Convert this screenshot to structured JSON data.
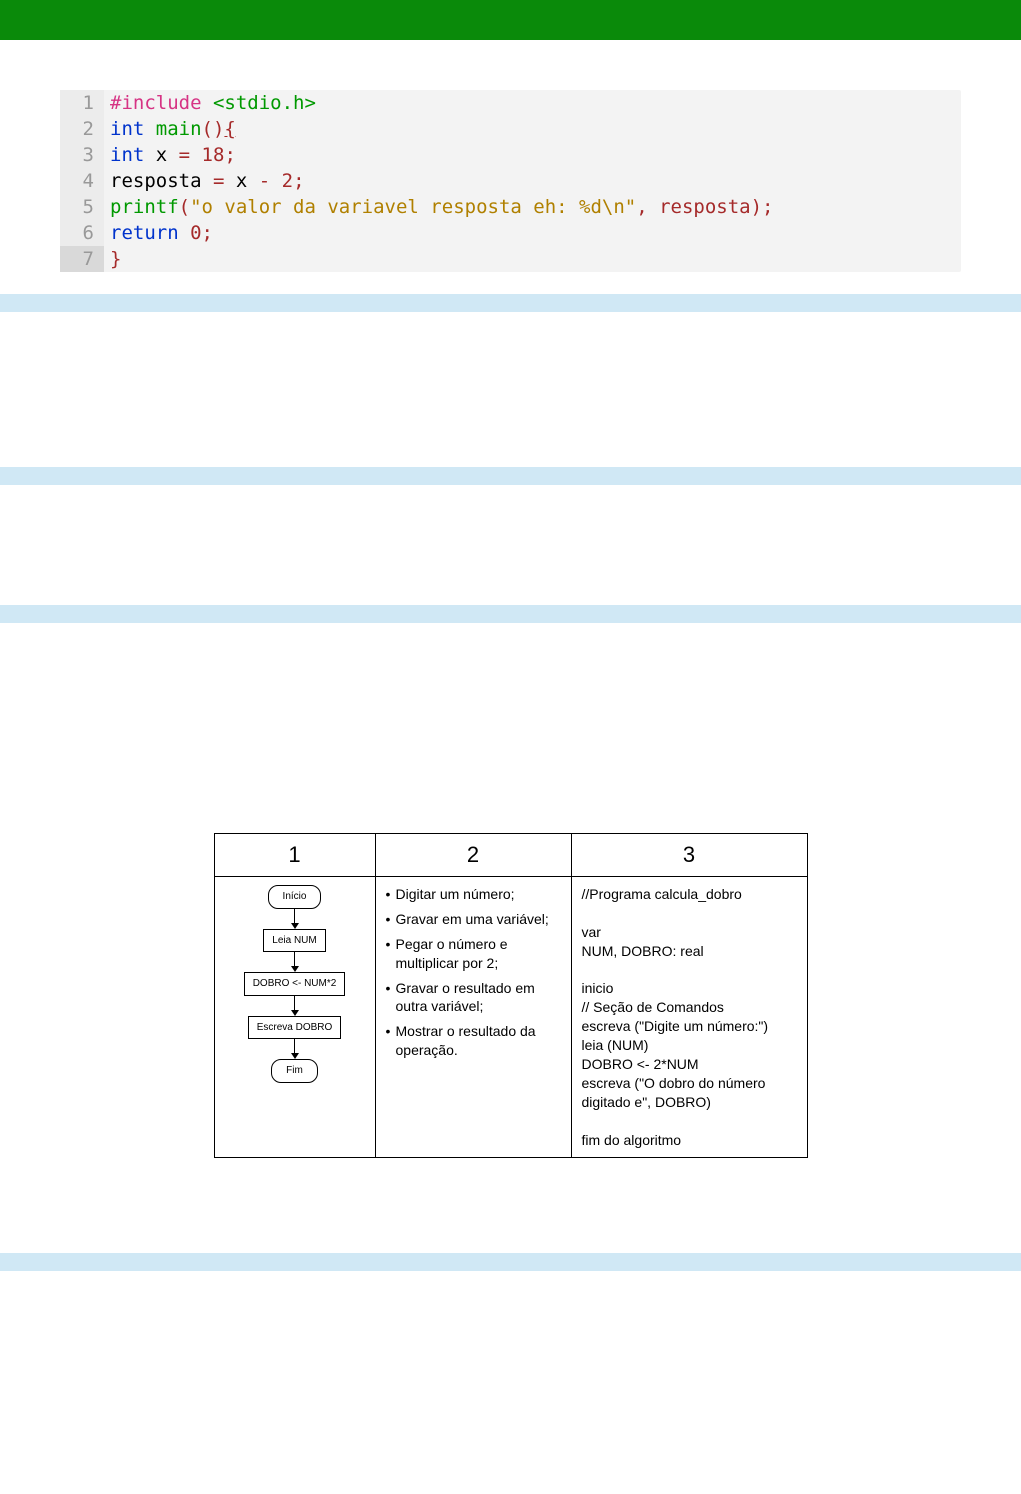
{
  "code": {
    "lines": [
      {
        "n": "1",
        "tokens": [
          {
            "t": "#include ",
            "c": "pre"
          },
          {
            "t": "<stdio.h>",
            "c": "type"
          }
        ]
      },
      {
        "n": "2",
        "tokens": [
          {
            "t": "int ",
            "c": "kw"
          },
          {
            "t": "main",
            "c": "func"
          },
          {
            "t": "()",
            "c": "punct"
          },
          {
            "t": "{",
            "c": "punct",
            "u": true
          }
        ]
      },
      {
        "n": "3",
        "tokens": [
          {
            "t": "    ",
            "c": "ident"
          },
          {
            "t": "int ",
            "c": "kw"
          },
          {
            "t": "x ",
            "c": "ident"
          },
          {
            "t": "= ",
            "c": "punct"
          },
          {
            "t": "18",
            "c": "num"
          },
          {
            "t": ";",
            "c": "punct"
          }
        ]
      },
      {
        "n": "4",
        "tokens": [
          {
            "t": "    resposta ",
            "c": "ident"
          },
          {
            "t": "= ",
            "c": "punct"
          },
          {
            "t": "x ",
            "c": "ident"
          },
          {
            "t": "- ",
            "c": "punct"
          },
          {
            "t": "2",
            "c": "num"
          },
          {
            "t": ";",
            "c": "punct"
          }
        ]
      },
      {
        "n": "5",
        "tokens": [
          {
            "t": "    ",
            "c": "ident"
          },
          {
            "t": "printf",
            "c": "func"
          },
          {
            "t": "(",
            "c": "punct"
          },
          {
            "t": "\"o valor da variavel resposta eh: %d\\n\"",
            "c": "str"
          },
          {
            "t": ", resposta);",
            "c": "punct"
          }
        ]
      },
      {
        "n": "6",
        "tokens": [
          {
            "t": "    ",
            "c": "ident"
          },
          {
            "t": "return ",
            "c": "kw"
          },
          {
            "t": "0",
            "c": "num"
          },
          {
            "t": ";",
            "c": "punct"
          }
        ]
      },
      {
        "n": "7",
        "tokens": [
          {
            "t": "}",
            "c": "punct"
          }
        ]
      }
    ]
  },
  "table": {
    "headers": [
      "1",
      "2",
      "3"
    ],
    "flow": {
      "start": "Início",
      "read": "Leia NUM",
      "calc": "DOBRO <- NUM*2",
      "write": "Escreva DOBRO",
      "end": "Fim"
    },
    "steps": [
      "Digitar um número;",
      "Gravar em uma variável;",
      "Pegar o número e multiplicar por 2;",
      "Gravar o resultado em outra variável;",
      "Mostrar o resultado da operação."
    ],
    "pseudo": "//Programa calcula_dobro\n\nvar\nNUM, DOBRO: real\n\ninicio\n// Seção de Comandos\nescreva (\"Digite um número:\")\nleia (NUM)\nDOBRO <- 2*NUM\nescreva (\"O dobro do número digitado e\", DOBRO)\n\nfim do algoritmo"
  }
}
